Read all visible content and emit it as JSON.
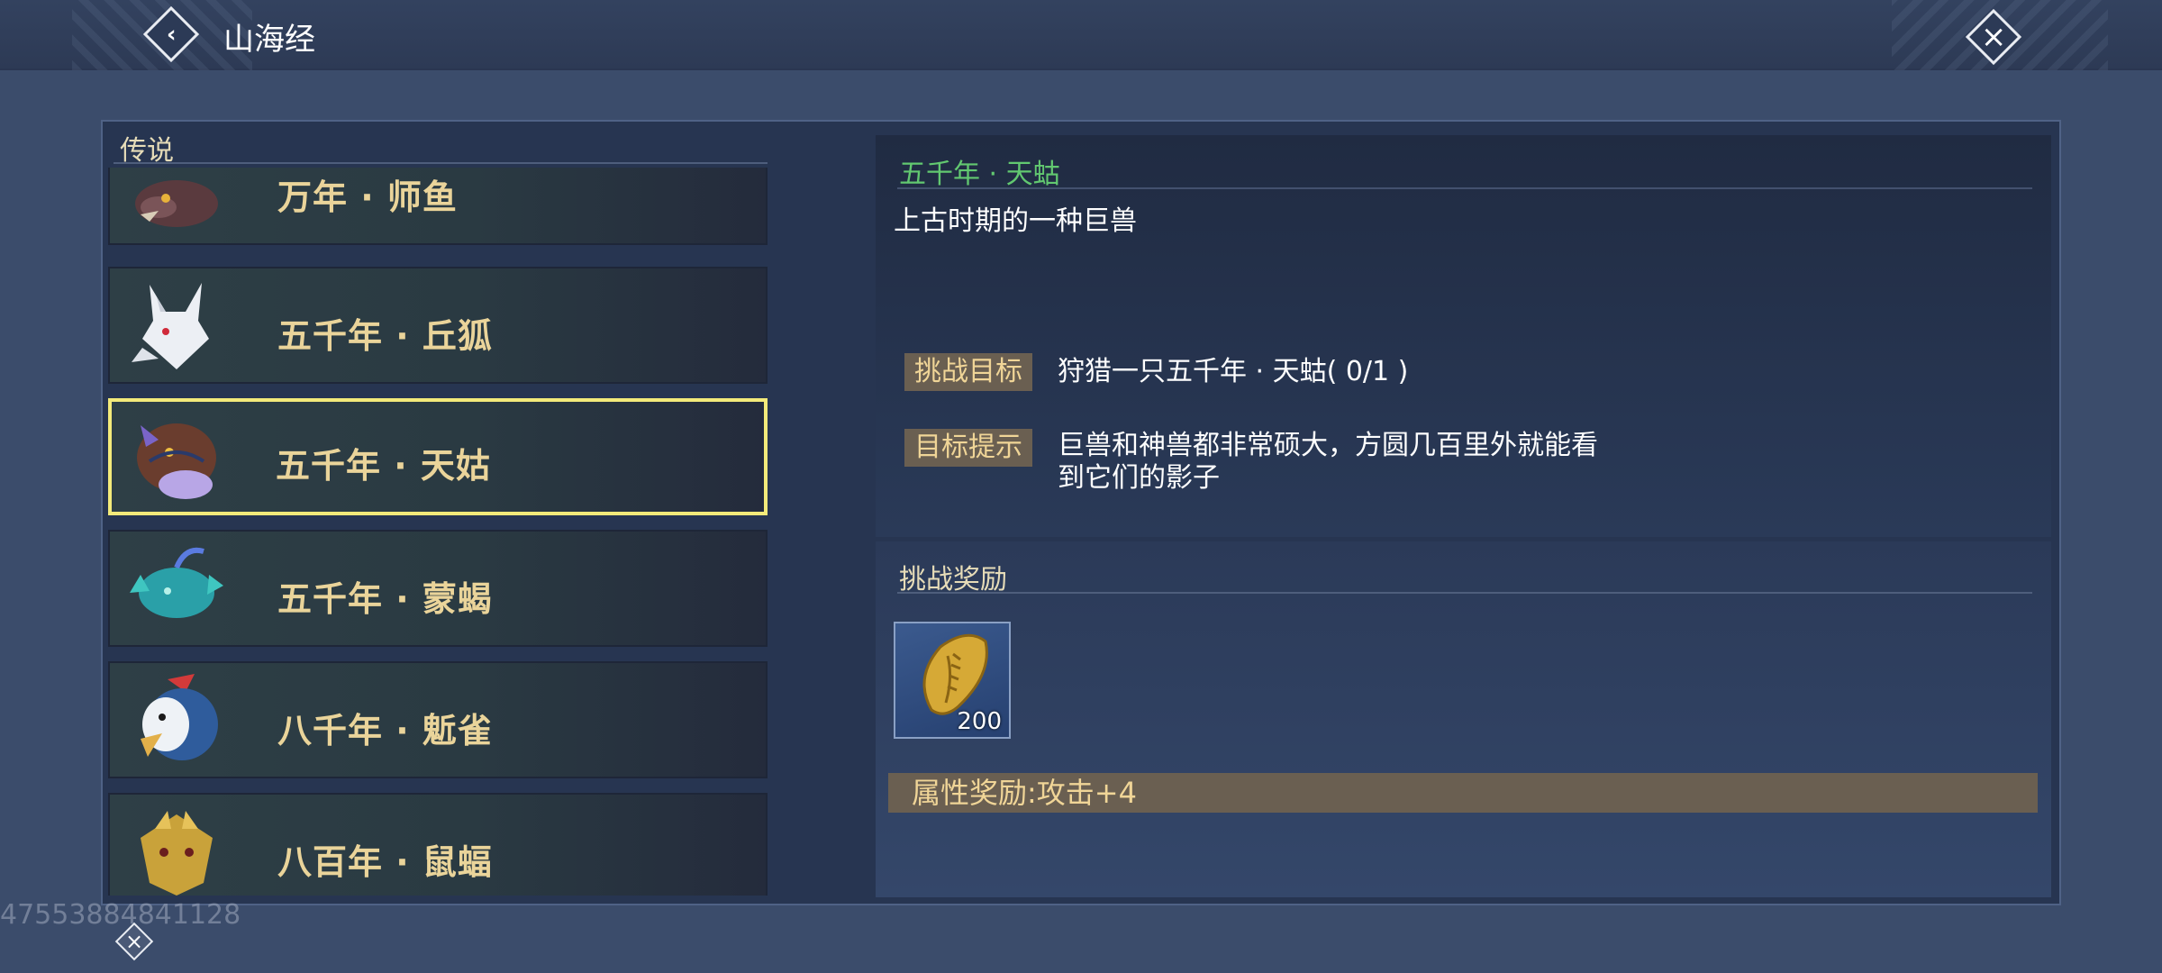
{
  "header": {
    "title": "山海经"
  },
  "left_panel": {
    "category": "传说",
    "items": [
      {
        "label": "万年 · 师鱼",
        "icon": "fish-beast-portrait"
      },
      {
        "label": "五千年 · 丘狐",
        "icon": "white-fox-portrait"
      },
      {
        "label": "五千年 · 天姑",
        "icon": "beast-portrait"
      },
      {
        "label": "五千年 · 蒙蝎",
        "icon": "scorpion-portrait"
      },
      {
        "label": "八千年 · 鬿雀",
        "icon": "bird-portrait"
      },
      {
        "label": "八百年 · 鼠蝠",
        "icon": "bat-portrait"
      }
    ],
    "selected": "五千年 · 天姑"
  },
  "detail": {
    "name": "五千年 · 天蛄",
    "description": "上古时期的一种巨兽",
    "goal_tag": "挑战目标",
    "goal_text": "狩猎一只五千年 · 天蛄( 0/1 )",
    "hint_tag": "目标提示",
    "hint_line1": "巨兽和神兽都非常硕大，方圆几百里外就能看",
    "hint_line2": "到它们的影子"
  },
  "reward": {
    "heading": "挑战奖励",
    "item_icon": "golden-shell-icon",
    "item_count": "200",
    "attribute": "属性奖励:攻击+4"
  },
  "watermark": "47553884841128",
  "colors": {
    "background": "#3b4c6b",
    "name_green": "#62c870",
    "label_gold": "#ead49a",
    "selected_border": "#f3ea7a",
    "tag_bg": "#6a5f51"
  }
}
